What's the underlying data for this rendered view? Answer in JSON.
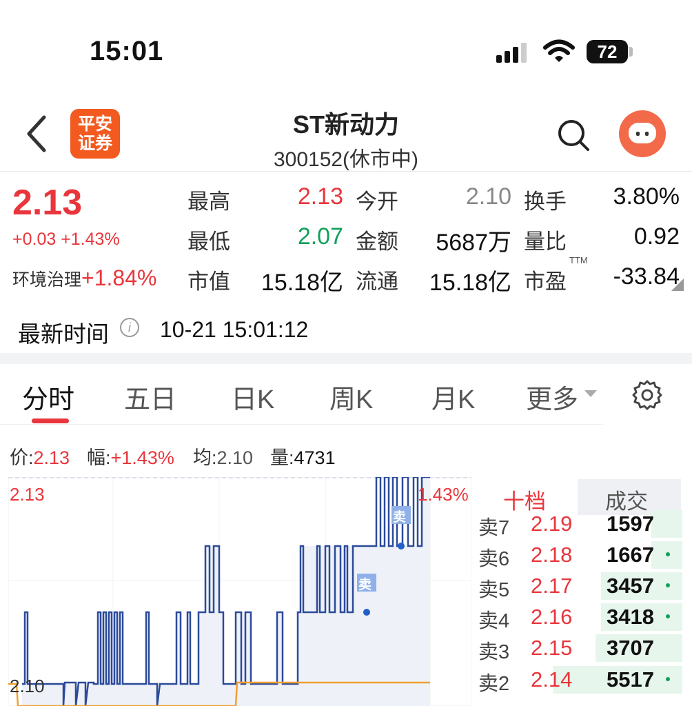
{
  "status_bar": {
    "time": "15:01",
    "battery": "72"
  },
  "header": {
    "logo_text": "平安\n证券",
    "stock_name": "ST新动力",
    "subtitle": "300152(休市中)"
  },
  "quote": {
    "price": "2.13",
    "change": "+0.03 +1.43%",
    "sector_name": "环境治理",
    "sector_change": "+1.84%",
    "fields": [
      {
        "label": "最高",
        "value": "2.13"
      },
      {
        "label": "今开",
        "value": "2.10"
      },
      {
        "label": "换手",
        "value": "3.80%"
      },
      {
        "label": "最低",
        "value": "2.07"
      },
      {
        "label": "金额",
        "value": "5687万"
      },
      {
        "label": "量比",
        "value": "0.92"
      },
      {
        "label": "市值",
        "value": "15.18亿"
      },
      {
        "label": "流通",
        "value": "15.18亿"
      },
      {
        "label": "市盈",
        "value": "-33.84",
        "suffix": "TTM"
      }
    ],
    "latest_time_label": "最新时间",
    "latest_time": "10-21 15:01:12"
  },
  "tabs": [
    "分时",
    "五日",
    "日K",
    "周K",
    "月K",
    "更多"
  ],
  "info_line": {
    "price_label": "价:",
    "price": "2.13",
    "amp_label": "幅:",
    "amp": "+1.43%",
    "avg_label": "均:",
    "avg": "2.10",
    "vol_label": "量:",
    "vol": "4731"
  },
  "chart": {
    "top_price_label": "2.13",
    "top_pct_label": "1.43%",
    "mid_price_label": "2.10",
    "sell_marker": "卖",
    "colors": {
      "price_line": "#2b4a9a",
      "avg_line": "#f0a030",
      "fill": "#eef1f8"
    }
  },
  "order_book": {
    "tab_left": "十档",
    "tab_right": "成交",
    "rows": [
      {
        "label": "卖7",
        "price": "2.19",
        "volume": "1597",
        "bar": 0.15,
        "dot": false
      },
      {
        "label": "卖6",
        "price": "2.18",
        "volume": "1667",
        "bar": 0.15,
        "dot": true
      },
      {
        "label": "卖5",
        "price": "2.17",
        "volume": "3457",
        "bar": 0.4,
        "dot": true
      },
      {
        "label": "卖4",
        "price": "2.16",
        "volume": "3418",
        "bar": 0.4,
        "dot": true
      },
      {
        "label": "卖3",
        "price": "2.15",
        "volume": "3707",
        "bar": 0.42,
        "dot": false
      },
      {
        "label": "卖2",
        "price": "2.14",
        "volume": "5517",
        "bar": 0.62,
        "dot": true
      }
    ]
  }
}
